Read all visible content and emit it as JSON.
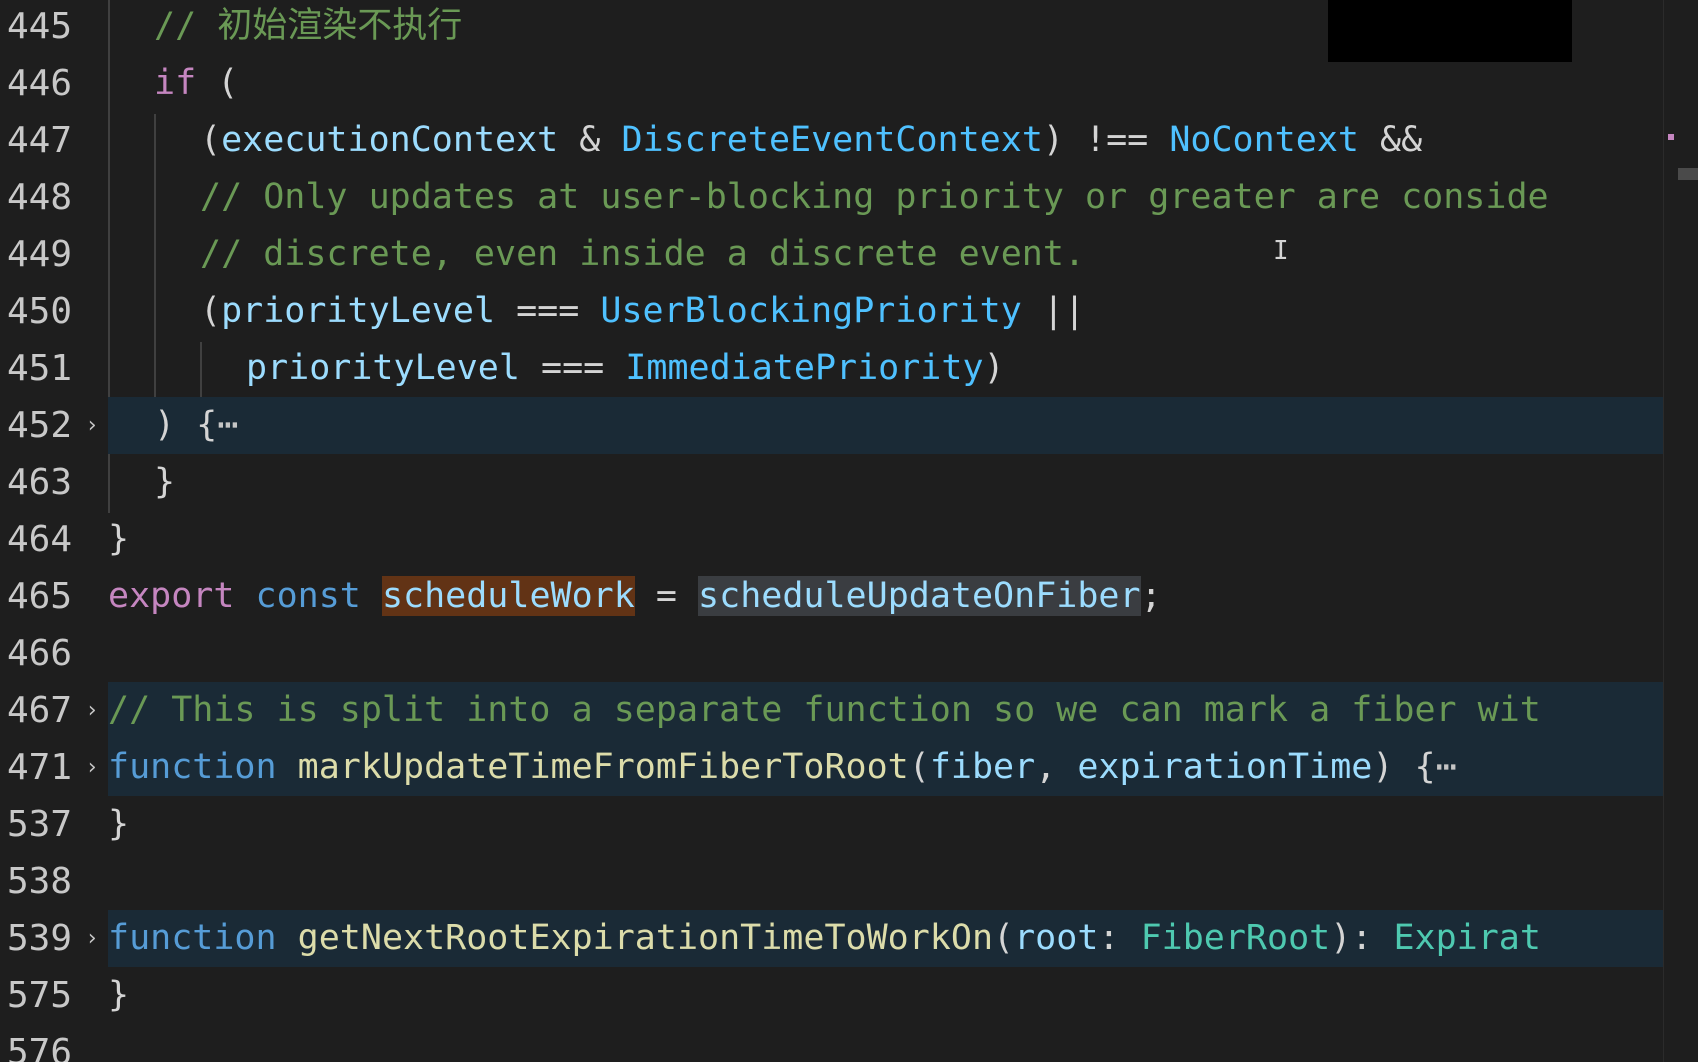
{
  "editor": {
    "lines": [
      {
        "num": "445",
        "tokens": [
          {
            "t": "// 初始渲染不执行",
            "c": "c"
          }
        ]
      },
      {
        "num": "446",
        "tokens": [
          {
            "t": "if",
            "c": "k"
          },
          {
            "t": " (",
            "c": "p"
          }
        ]
      },
      {
        "num": "447",
        "tokens": [
          {
            "t": "(",
            "c": "p"
          },
          {
            "t": "executionContext",
            "c": "v"
          },
          {
            "t": " & ",
            "c": "p"
          },
          {
            "t": "DiscreteEventContext",
            "c": "n"
          },
          {
            "t": ") !== ",
            "c": "p"
          },
          {
            "t": "NoContext",
            "c": "n"
          },
          {
            "t": " &&",
            "c": "p"
          }
        ]
      },
      {
        "num": "448",
        "tokens": [
          {
            "t": "// Only updates at user-blocking priority or greater are conside",
            "c": "c"
          }
        ]
      },
      {
        "num": "449",
        "tokens": [
          {
            "t": "// discrete, even inside a discrete event.",
            "c": "c"
          }
        ]
      },
      {
        "num": "450",
        "tokens": [
          {
            "t": "(",
            "c": "p"
          },
          {
            "t": "priorityLevel",
            "c": "v"
          },
          {
            "t": " === ",
            "c": "p"
          },
          {
            "t": "UserBlockingPriority",
            "c": "n"
          },
          {
            "t": " ||",
            "c": "p"
          }
        ]
      },
      {
        "num": "451",
        "tokens": [
          {
            "t": "priorityLevel",
            "c": "v"
          },
          {
            "t": " === ",
            "c": "p"
          },
          {
            "t": "ImmediatePriority",
            "c": "n"
          },
          {
            "t": ")",
            "c": "p"
          }
        ]
      },
      {
        "num": "452",
        "fold": "›",
        "tokens": [
          {
            "t": ") {",
            "c": "p"
          },
          {
            "t": "⋯",
            "c": "ellipsis"
          }
        ]
      },
      {
        "num": "463",
        "tokens": [
          {
            "t": "}",
            "c": "p"
          }
        ]
      },
      {
        "num": "464",
        "tokens": [
          {
            "t": "}",
            "c": "p"
          }
        ]
      },
      {
        "num": "465",
        "tokens": [
          {
            "t": "export",
            "c": "k"
          },
          {
            "t": " ",
            "c": "p"
          },
          {
            "t": "const",
            "c": "s"
          },
          {
            "t": " ",
            "c": "p"
          },
          {
            "t": "scheduleWork",
            "c": "v hl-word"
          },
          {
            "t": " = ",
            "c": "p"
          },
          {
            "t": "scheduleUpdateOnFiber",
            "c": "v hl-sel"
          },
          {
            "t": ";",
            "c": "p"
          }
        ]
      },
      {
        "num": "466",
        "tokens": []
      },
      {
        "num": "467",
        "fold": "›",
        "tokens": [
          {
            "t": "// This is split into a separate function so we can mark a fiber wit",
            "c": "c"
          }
        ]
      },
      {
        "num": "471",
        "fold": "›",
        "tokens": [
          {
            "t": "function",
            "c": "s"
          },
          {
            "t": " ",
            "c": "p"
          },
          {
            "t": "markUpdateTimeFromFiberToRoot",
            "c": "f"
          },
          {
            "t": "(",
            "c": "p"
          },
          {
            "t": "fiber",
            "c": "v"
          },
          {
            "t": ", ",
            "c": "p"
          },
          {
            "t": "expirationTime",
            "c": "v"
          },
          {
            "t": ") {",
            "c": "p"
          },
          {
            "t": "⋯",
            "c": "ellipsis"
          }
        ]
      },
      {
        "num": "537",
        "tokens": [
          {
            "t": "}",
            "c": "p"
          }
        ]
      },
      {
        "num": "538",
        "tokens": []
      },
      {
        "num": "539",
        "fold": "›",
        "tokens": [
          {
            "t": "function",
            "c": "s"
          },
          {
            "t": " ",
            "c": "p"
          },
          {
            "t": "getNextRootExpirationTimeToWorkOn",
            "c": "f"
          },
          {
            "t": "(",
            "c": "p"
          },
          {
            "t": "root",
            "c": "v"
          },
          {
            "t": ": ",
            "c": "p"
          },
          {
            "t": "FiberRoot",
            "c": "t"
          },
          {
            "t": "): ",
            "c": "p"
          },
          {
            "t": "Expirat",
            "c": "t"
          }
        ]
      },
      {
        "num": "575",
        "tokens": [
          {
            "t": "}",
            "c": "p"
          }
        ]
      },
      {
        "num": "576",
        "tokens": []
      }
    ]
  }
}
